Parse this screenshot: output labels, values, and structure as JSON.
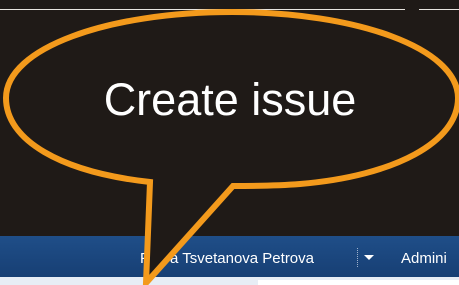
{
  "header": {
    "user_name": "Petya Tsvetanova Petrova",
    "admin_label": "Admini"
  },
  "callout": {
    "text": "Create issue"
  },
  "icons": {
    "user_menu": "chevron-down-icon"
  },
  "colors": {
    "callout_border": "#f39a1c",
    "callout_fill": "#1f1a17",
    "header_bg": "#1f4e88",
    "page_bg": "#1f1a17"
  }
}
